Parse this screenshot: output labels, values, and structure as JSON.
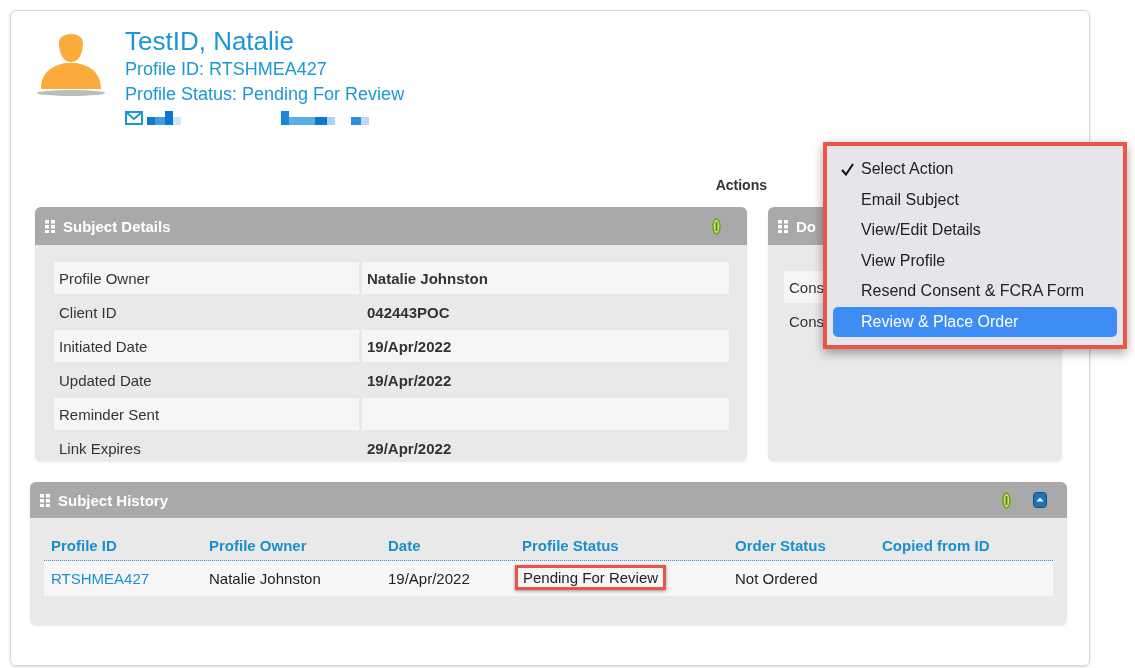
{
  "profile": {
    "name": "TestID, Natalie",
    "profile_id": "Profile ID: RTSHMEA427",
    "status": "Profile Status: Pending For Review"
  },
  "actions": {
    "label": "Actions",
    "menu": [
      {
        "label": "Select Action",
        "selected": true,
        "highlighted": false
      },
      {
        "label": "Email Subject",
        "selected": false,
        "highlighted": false
      },
      {
        "label": "View/Edit Details",
        "selected": false,
        "highlighted": false
      },
      {
        "label": "View Profile",
        "selected": false,
        "highlighted": false
      },
      {
        "label": "Resend Consent & FCRA Form",
        "selected": false,
        "highlighted": false
      },
      {
        "label": "Review & Place Order",
        "selected": false,
        "highlighted": true
      }
    ]
  },
  "subject_details": {
    "title": "Subject Details",
    "rows": [
      {
        "label": "Profile Owner",
        "value": "Natalie Johnston"
      },
      {
        "label": "Client ID",
        "value": "042443POC"
      },
      {
        "label": "Initiated Date",
        "value": "19/Apr/2022"
      },
      {
        "label": "Updated Date",
        "value": "19/Apr/2022"
      },
      {
        "label": "Reminder Sent"
      },
      {
        "label": "Link Expires",
        "value": "29/Apr/2022"
      }
    ]
  },
  "documents": {
    "title": "Do",
    "rows": [
      "Cons",
      "Cons"
    ]
  },
  "subject_history": {
    "title": "Subject History",
    "columns": [
      "Profile ID",
      "Profile Owner",
      "Date",
      "Profile Status",
      "Order Status",
      "Copied from ID"
    ],
    "rows": [
      {
        "cells": [
          {
            "text": "RTSHMEA427",
            "kind": "link",
            "flagged": false
          },
          {
            "text": "Natalie Johnston",
            "kind": "text",
            "flagged": false
          },
          {
            "text": "19/Apr/2022",
            "kind": "text",
            "flagged": false
          },
          {
            "text": "Pending For Review",
            "kind": "text",
            "flagged": true
          },
          {
            "text": "Not Ordered",
            "kind": "text",
            "flagged": false
          }
        ]
      }
    ]
  }
}
